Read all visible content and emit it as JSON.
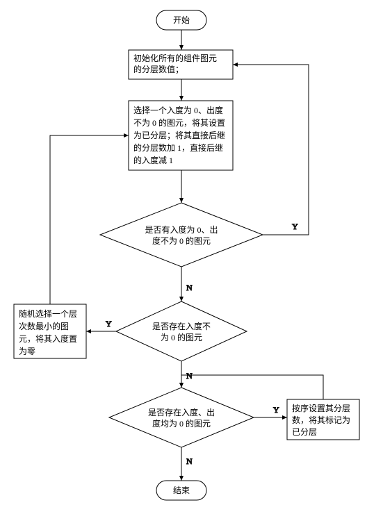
{
  "chart_data": {
    "type": "flowchart",
    "nodes": [
      {
        "id": "start",
        "shape": "terminator",
        "text": "开始"
      },
      {
        "id": "init",
        "shape": "process",
        "text": "初始化所有的组件图元的分层数值；"
      },
      {
        "id": "proc1",
        "shape": "process",
        "text": "选择一个入度为 0、出度不为 0 的图元，将其设置为已分层；将其直接后继的分层数加 1，直接后继的入度减 1"
      },
      {
        "id": "dec1",
        "shape": "decision",
        "text": "是否有入度为 0、出度不为 0 的图元"
      },
      {
        "id": "dec2",
        "shape": "decision",
        "text": "是否存在入度不为 0 的图元"
      },
      {
        "id": "side",
        "shape": "process",
        "text": "随机选择一个层次数最小的图元，将其入度置为零"
      },
      {
        "id": "dec3",
        "shape": "decision",
        "text": "是否存在入度、出度均为 0 的图元"
      },
      {
        "id": "proc2",
        "shape": "process",
        "text": "按序设置其分层数，将其标记为已分层"
      },
      {
        "id": "end",
        "shape": "terminator",
        "text": "结束"
      }
    ],
    "edges": [
      {
        "from": "start",
        "to": "init"
      },
      {
        "from": "init",
        "to": "proc1"
      },
      {
        "from": "proc1",
        "to": "dec1"
      },
      {
        "from": "dec1",
        "to": "proc1",
        "label": "Y"
      },
      {
        "from": "dec1",
        "to": "dec2",
        "label": "N"
      },
      {
        "from": "dec2",
        "to": "side",
        "label": "Y"
      },
      {
        "from": "side",
        "to": "proc1"
      },
      {
        "from": "dec2",
        "to": "dec3",
        "label": "N"
      },
      {
        "from": "dec3",
        "to": "proc2",
        "label": "Y"
      },
      {
        "from": "proc2",
        "to": "dec3"
      },
      {
        "from": "dec3",
        "to": "end",
        "label": "N"
      }
    ]
  },
  "labels": {
    "start": "开始",
    "init1": "初始化所有的组件图元",
    "init2": "的分层数值；",
    "p1a": "选择一个入度为 0、出度",
    "p1b": "不为 0 的图元，将其设置",
    "p1c": "为已分层；将其直接后继",
    "p1d": "的分层数加 1，直接后继",
    "p1e": "的入度减 1",
    "d1a": "是否有入度为 0、出",
    "d1b": "度不为 0 的图元",
    "d2a": "是否存在入度不",
    "d2b": "为 0 的图元",
    "s1": "随机选择一个层",
    "s2": "次数最小的图",
    "s3": "元，将其入度置",
    "s4": "为零",
    "d3a": "是否存在入度、出",
    "d3b": "度均为 0 的图元",
    "p2a": "按序设置其分层",
    "p2b": "数，将其标记为",
    "p2c": "已分层",
    "end": "结束",
    "Y": "Y",
    "N": "N"
  }
}
